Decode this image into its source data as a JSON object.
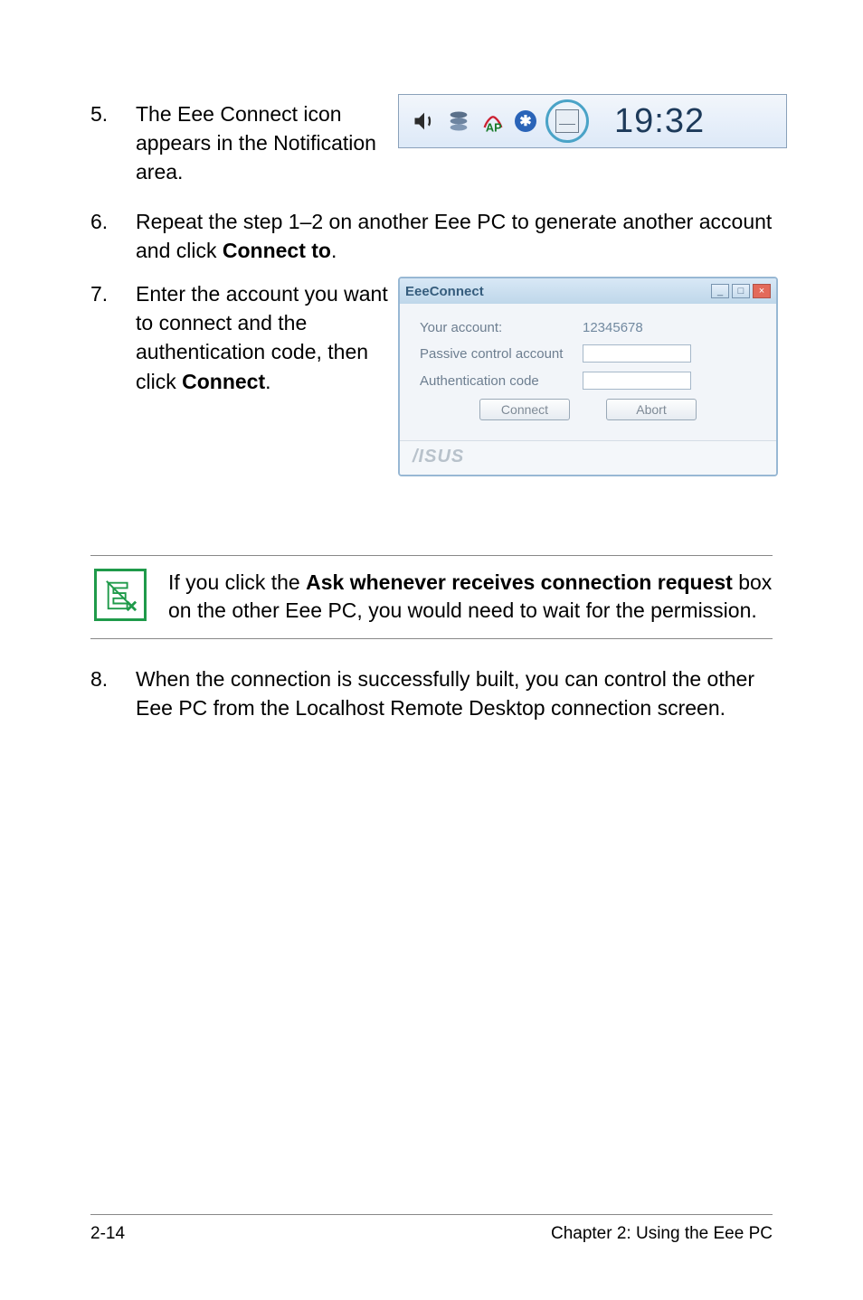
{
  "steps": {
    "s5": {
      "num": "5.",
      "text": "The Eee Connect icon appears in the Notification area."
    },
    "s6": {
      "num": "6.",
      "text_a": "Repeat the step 1–2 on another Eee PC to generate another account and click ",
      "bold": "Connect to",
      "text_b": "."
    },
    "s7": {
      "num": "7.",
      "text_a": "Enter the account you want to connect and the authentication code, then click ",
      "bold": "Connect",
      "text_b": "."
    },
    "s8": {
      "num": "8.",
      "text": "When the connection is successfully built, you can control the other Eee PC from the Localhost Remote Desktop connection screen."
    }
  },
  "tray": {
    "time": "19:32"
  },
  "eeeconnect": {
    "title": "EeeConnect",
    "labels": {
      "your_account": "Your account:",
      "passive": "Passive control account",
      "auth": "Authentication code"
    },
    "account_value": "12345678",
    "buttons": {
      "connect": "Connect",
      "abort": "Abort"
    },
    "brand": "/ISUS"
  },
  "note": {
    "text_a": "If you click the ",
    "bold": "Ask whenever receives connection request",
    "text_b": " box on the other Eee PC, you would need to wait for the permission."
  },
  "footer": {
    "left": "2-14",
    "right": "Chapter 2: Using the Eee PC"
  }
}
